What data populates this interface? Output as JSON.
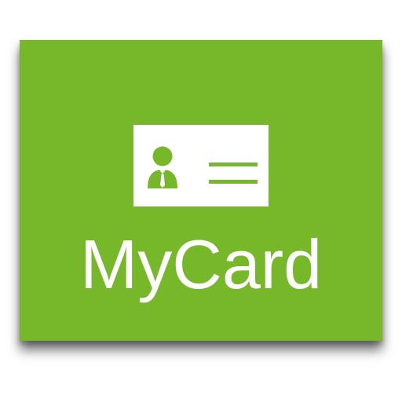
{
  "app": {
    "name": "MyCard",
    "icon": "id-card-icon"
  },
  "colors": {
    "tile_background": "#77b72a",
    "foreground": "#ffffff",
    "glyph": "#77b72a",
    "page_background": "#ffffff"
  }
}
